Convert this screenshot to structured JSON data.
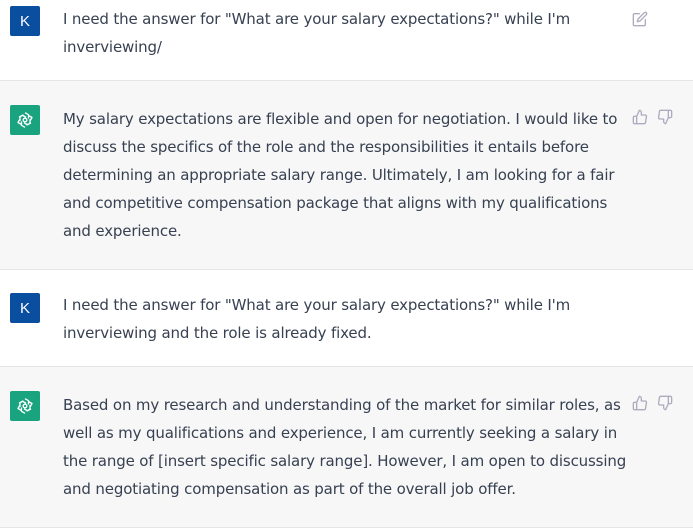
{
  "conversation": {
    "messages": [
      {
        "role": "user",
        "avatar_letter": "K",
        "text": "I need the answer for \"What are your salary expectations?\" while I'm inverviewing/"
      },
      {
        "role": "assistant",
        "text": "My salary expectations are flexible and open for negotiation. I would like to discuss the specifics of the role and the responsibilities it entails before determining an appropriate salary range. Ultimately, I am looking for a fair and competitive compensation package that aligns with my qualifications and experience."
      },
      {
        "role": "user",
        "avatar_letter": "K",
        "text": "I need the answer for \"What are your salary expectations?\" while I'm inverviewing and the role is already fixed."
      },
      {
        "role": "assistant",
        "text": "Based on my research and understanding of the market for similar roles, as well as my qualifications and experience, I am currently seeking a salary in the range of [insert specific salary range]. However, I am open to discussing and negotiating compensation as part of the overall job offer."
      }
    ]
  },
  "colors": {
    "user_avatar_bg": "#0a4ea0",
    "assistant_avatar_bg": "#19a37f",
    "assistant_row_bg": "#f7f7f8",
    "icon_gray": "#acacbe"
  },
  "icons": {
    "edit": "edit-icon",
    "thumbs_up": "thumbs-up-icon",
    "thumbs_down": "thumbs-down-icon",
    "assistant_logo": "openai-logo-icon"
  }
}
